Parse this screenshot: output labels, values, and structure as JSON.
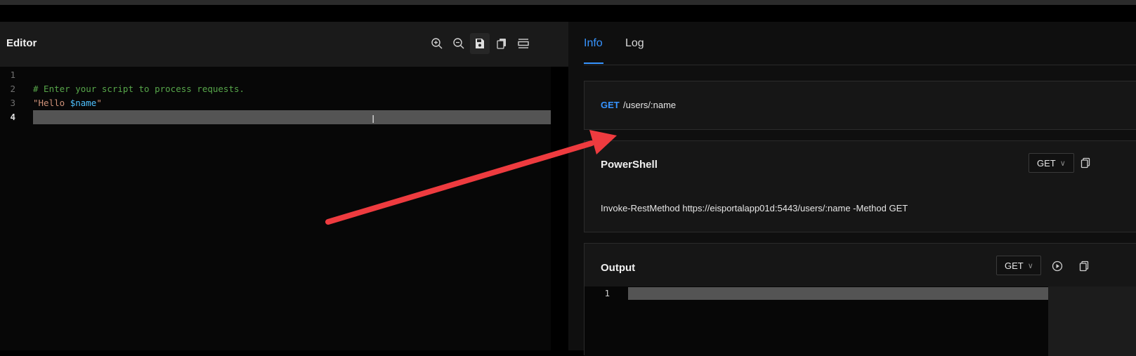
{
  "editor": {
    "title": "Editor",
    "toolbar": [
      {
        "icon": "zoom-in-icon"
      },
      {
        "icon": "zoom-out-icon"
      },
      {
        "icon": "save-icon"
      },
      {
        "icon": "copy-icon"
      },
      {
        "icon": "wrap-icon"
      }
    ],
    "lines": [
      {
        "number": "1",
        "comment": "",
        "string_start": "",
        "variable": "",
        "string_end": ""
      },
      {
        "number": "2",
        "comment": "# Enter your script to process requests.",
        "string_start": "",
        "variable": "",
        "string_end": ""
      },
      {
        "number": "3",
        "comment": "",
        "string_start": "\"Hello ",
        "variable": "$name",
        "string_end": "\""
      },
      {
        "number": "4",
        "comment": "",
        "string_start": "",
        "variable": "",
        "string_end": ""
      }
    ]
  },
  "tabs": {
    "info": "Info",
    "log": "Log",
    "active": "Info"
  },
  "route": {
    "method": "GET",
    "path": "/users/:name"
  },
  "powershell": {
    "title": "PowerShell",
    "method": "GET",
    "command": "Invoke-RestMethod https://eisportalapp01d:5443/users/:name -Method GET"
  },
  "output": {
    "title": "Output",
    "method": "GET",
    "line_number": "1"
  },
  "colors": {
    "accent": "#3794ff",
    "annotation_arrow": "#ee3b3f",
    "comment": "#57a64a",
    "string": "#ce9178",
    "variable": "#4fc1ff"
  }
}
